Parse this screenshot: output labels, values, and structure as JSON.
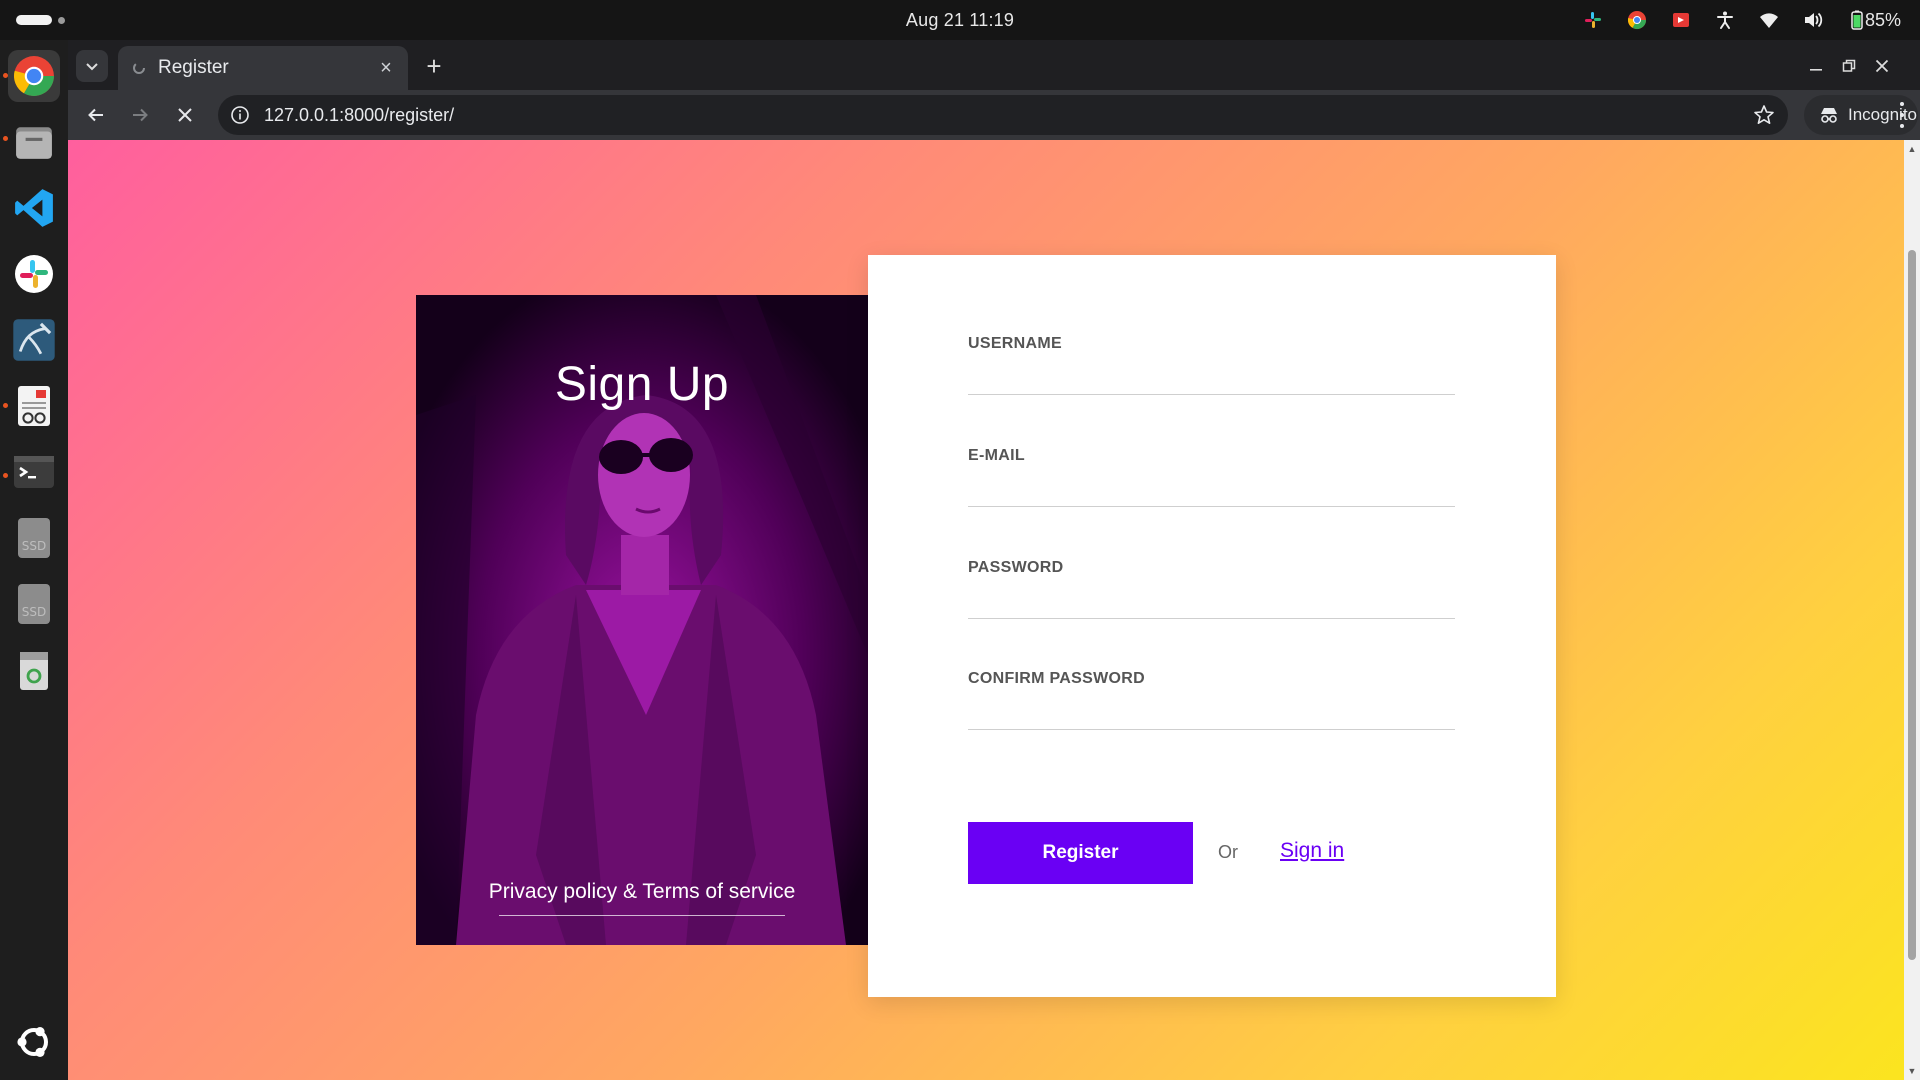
{
  "system": {
    "clock": "Aug 21  11:19",
    "battery": "85%"
  },
  "browser": {
    "tab_title": "Register",
    "url": "127.0.0.1:8000/register/",
    "incognito_label": "Incognito"
  },
  "page": {
    "hero_title": "Sign Up",
    "hero_link": "Privacy policy & Terms of service",
    "fields": {
      "username_label": "USERNAME",
      "email_label": "E-MAIL",
      "password_label": "PASSWORD",
      "confirm_label": "CONFIRM PASSWORD"
    },
    "register_label": "Register",
    "or_text": "Or",
    "signin_label": "Sign in"
  },
  "colors": {
    "accent": "#6a00f4",
    "gradient_start": "#ff5f9e",
    "gradient_end": "#fbe51e"
  },
  "dock": {
    "icons": [
      "chrome-icon",
      "files-icon",
      "vscode-icon",
      "slack-icon",
      "mysql-workbench-icon",
      "document-viewer-icon",
      "terminal-icon",
      "ssd-drive-icon",
      "ssd-drive-icon",
      "trash-icon",
      "ubuntu-apps-icon"
    ]
  }
}
